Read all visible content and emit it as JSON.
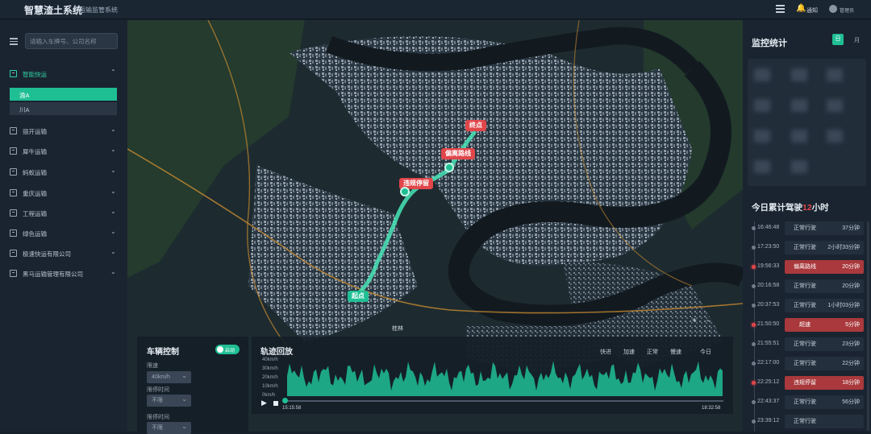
{
  "topbar": {
    "title": "智慧渣土系统",
    "subtitle": "运输监管系统",
    "notice": "通知",
    "user": "管理员"
  },
  "sidebar": {
    "search_placeholder": "请输入车牌号、公司名称",
    "groups": [
      {
        "label": "智能快运",
        "expanded": true,
        "active": true
      },
      {
        "label": "丽开运输"
      },
      {
        "label": "犀牛运输"
      },
      {
        "label": "蚂蚁运输"
      },
      {
        "label": "重庆运输"
      },
      {
        "label": "工程运输"
      },
      {
        "label": "绿色运输"
      },
      {
        "label": "极速快运有限公司"
      },
      {
        "label": "黑马运输管理有限公司"
      }
    ],
    "sub_items": [
      "渝A",
      "川A"
    ]
  },
  "map": {
    "markers": {
      "destination": "终点",
      "deviation": "偏离路线",
      "illegal_stop": "违规停留",
      "start": "起点"
    },
    "place_label": "桂林",
    "zoom_in": "+",
    "zoom_out": "-"
  },
  "right": {
    "title": "监控统计",
    "day_btn": "日",
    "month_btn": "月",
    "today_prefix": "今日累计驾驶",
    "today_hours": "12",
    "today_suffix": "小时",
    "events": [
      {
        "time": "16:46:48",
        "state": "正常行驶",
        "duration": "37分钟",
        "alarm": false
      },
      {
        "time": "17:23:50",
        "state": "正常行驶",
        "duration": "2小时33分钟",
        "alarm": false
      },
      {
        "time": "19:56:33",
        "state": "偏离路线",
        "duration": "20分钟",
        "alarm": true
      },
      {
        "time": "20:16:58",
        "state": "正常行驶",
        "duration": "20分钟",
        "alarm": false
      },
      {
        "time": "20:37:53",
        "state": "正常行驶",
        "duration": "1小时03分钟",
        "alarm": false
      },
      {
        "time": "21:50:50",
        "state": "超速",
        "duration": "5分钟",
        "alarm": true
      },
      {
        "time": "21:55:51",
        "state": "正常行驶",
        "duration": "23分钟",
        "alarm": false
      },
      {
        "time": "22:17:00",
        "state": "正常行驶",
        "duration": "22分钟",
        "alarm": false
      },
      {
        "time": "22:25:12",
        "state": "违规停留",
        "duration": "18分钟",
        "alarm": true
      },
      {
        "time": "22:43:37",
        "state": "正常行驶",
        "duration": "56分钟",
        "alarm": false
      },
      {
        "time": "23:39:12",
        "state": "正常行驶",
        "duration": "",
        "alarm": false
      }
    ]
  },
  "vehicle_control": {
    "title": "车辆控制",
    "toggle_label": "启动",
    "speed_label": "限速",
    "speed_value": "40km/h",
    "stop_label": "限停时间",
    "stop_value": "不限",
    "time_label": "限停时间",
    "time_value": "不限"
  },
  "track_playback": {
    "title": "轨迹回放",
    "speed_buttons": [
      "快进",
      "加速",
      "正常",
      "慢速"
    ],
    "today": "今日",
    "y_ticks": [
      "40km/h",
      "30km/h",
      "20km/h",
      "10km/h",
      "0km/h"
    ],
    "start_time": "15:15:58",
    "end_time": "18:32:58",
    "progress": 0.0
  },
  "colors": {
    "accent": "#1fbf94",
    "alarm": "#e0464a",
    "panel": "#1a2430"
  }
}
